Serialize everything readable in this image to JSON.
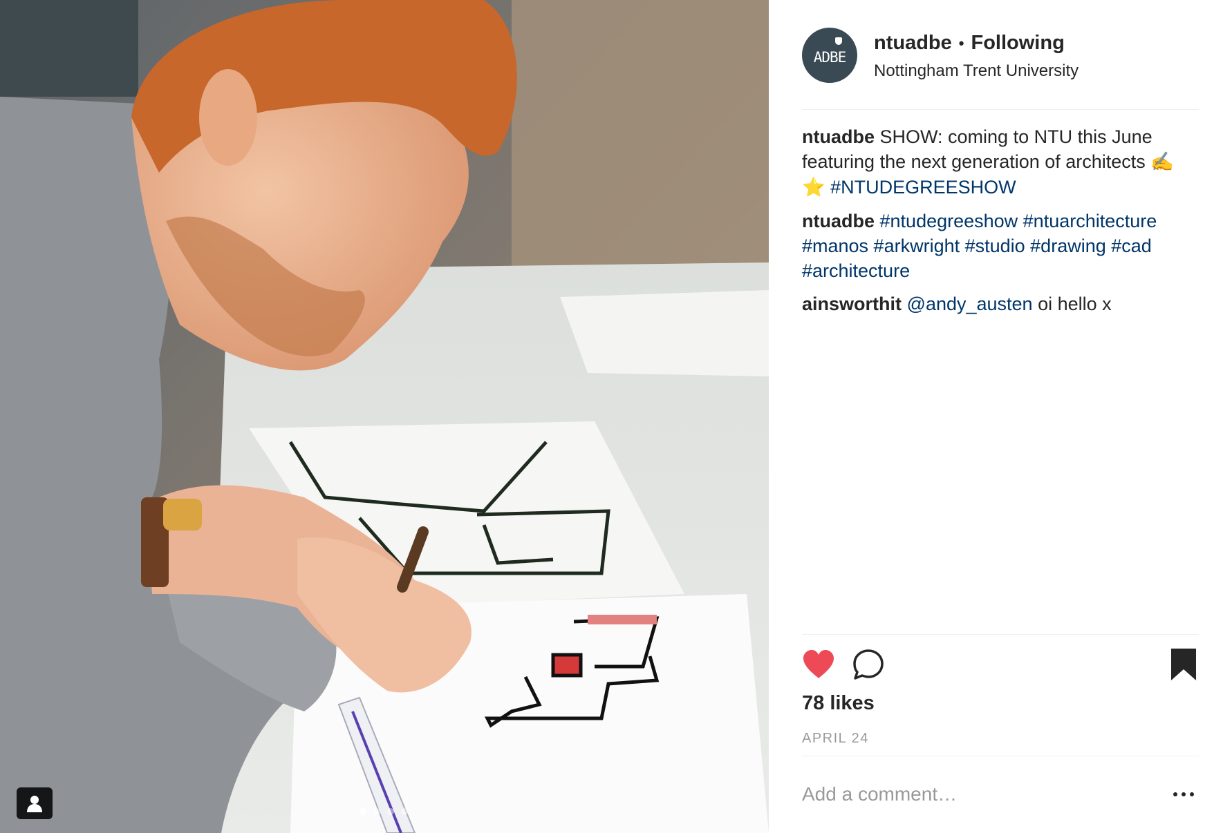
{
  "post": {
    "username": "ntuadbe",
    "separator": "•",
    "follow_status": "Following",
    "location": "Nottingham Trent University",
    "avatar_text": "ADBE"
  },
  "comments": [
    {
      "user": "ntuadbe",
      "text": "SHOW: coming to NTU this June featuring the next generation of architects",
      "emoji": "✍️ ⭐️",
      "hashtag": "#NTUDEGREESHOW"
    },
    {
      "user": "ntuadbe",
      "hashtags": "#ntudegreeshow #ntuarchitecture #manos #arkwright #studio #drawing #cad #architecture"
    },
    {
      "user": "ainsworthit",
      "mention": "@andy_austen",
      "text": "oi hello x"
    }
  ],
  "actions": {
    "liked": true,
    "like_icon": "heart-icon",
    "comment_icon": "speech-bubble-icon",
    "save_icon": "bookmark-icon",
    "saved": true
  },
  "likes": "78 likes",
  "date": "APRIL 24",
  "add_comment_placeholder": "Add a comment…",
  "carousel": {
    "count": 4,
    "active": 1
  },
  "colors": {
    "heart": "#ed4956",
    "link": "#003569",
    "muted": "#999999",
    "avatar_bg": "#3a4a54"
  }
}
